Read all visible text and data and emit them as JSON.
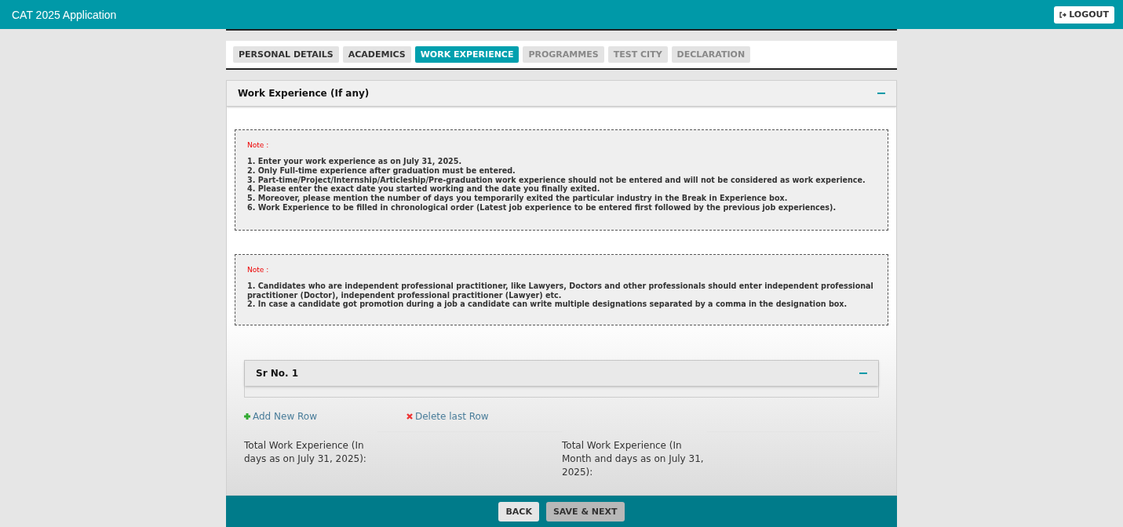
{
  "header": {
    "title": "CAT 2025 Application",
    "logout": "LOGOUT"
  },
  "tabs": [
    {
      "label": "PERSONAL DETAILS",
      "selected": false,
      "completed": true
    },
    {
      "label": "ACADEMICS",
      "selected": false,
      "completed": true
    },
    {
      "label": "WORK EXPERIENCE",
      "selected": true,
      "completed": false
    },
    {
      "label": "PROGRAMMES",
      "selected": false,
      "completed": false
    },
    {
      "label": "TEST CITY",
      "selected": false,
      "completed": false
    },
    {
      "label": "DECLARATION",
      "selected": false,
      "completed": false
    }
  ],
  "section": {
    "title": "Work Experience (If any)",
    "expanded": true,
    "notes": [
      {
        "heading": "Note :",
        "items": [
          "1. Enter your work experience as on July 31, 2025.",
          "2. Only Full-time experience after graduation must be entered.",
          "3. Part-time/Project/Internship/Articleship/Pre-graduation work experience should not be entered and will not be considered as work experience.",
          "4. Please enter the exact date you started working and the date you finally exited.",
          "5. Moreover, please mention the number of days you temporarily exited the particular industry in the Break in Experience box.",
          "6. Work Experience to be filled in chronological order (Latest job experience to be entered first followed by the previous job experiences)."
        ]
      },
      {
        "heading": "Note :",
        "items": [
          "1. Candidates who are independent professional practitioner, like Lawyers, Doctors and other professionals should enter independent professional practitioner (Doctor), independent professional practitioner (Lawyer) etc.",
          "2. In case a candidate got promotion during a job a candidate can write multiple designations separated by a comma in the designation box."
        ]
      }
    ],
    "row": {
      "title": "Sr No. 1",
      "expanded": true
    },
    "add_row": "Add New Row",
    "delete_row": "Delete last Row",
    "totals": [
      "Total Work Experience (In days as on July 31, 2025):",
      "Total Work Experience (In Month and days as on July 31, 2025):"
    ]
  },
  "footer": {
    "buttons": [
      "BACK",
      "SAVE & NEXT"
    ]
  }
}
